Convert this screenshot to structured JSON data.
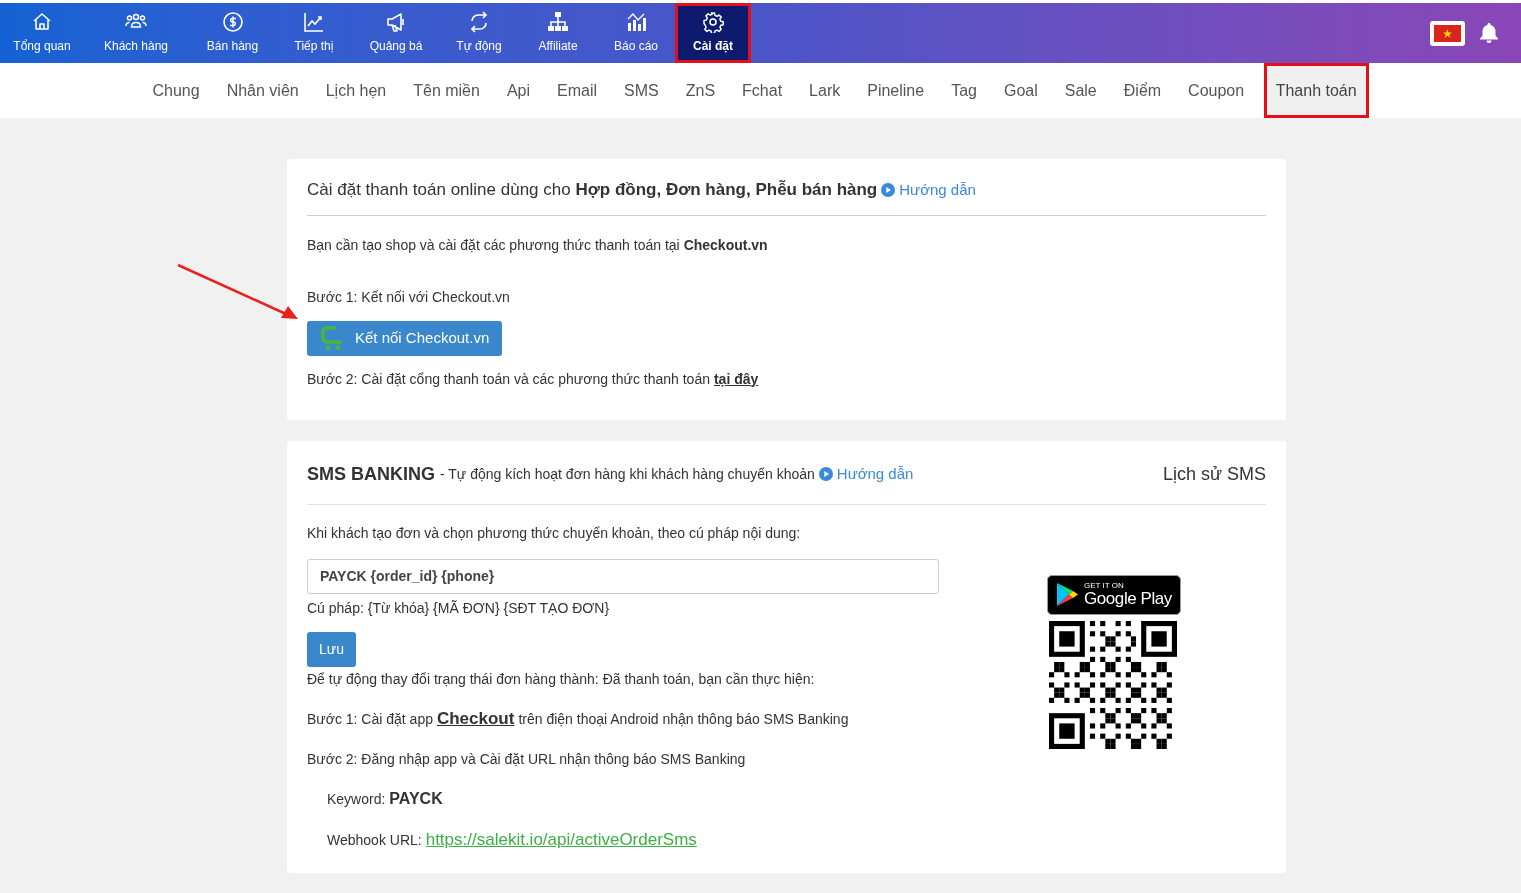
{
  "top_nav": [
    {
      "label": "Tổng quan",
      "selected": false
    },
    {
      "label": "Khách hàng",
      "selected": false
    },
    {
      "label": "Bán hàng",
      "selected": false
    },
    {
      "label": "Tiếp thị",
      "selected": false
    },
    {
      "label": "Quảng bá",
      "selected": false
    },
    {
      "label": "Tự động",
      "selected": false
    },
    {
      "label": "Affiliate",
      "selected": false
    },
    {
      "label": "Báo cáo",
      "selected": false
    },
    {
      "label": "Cài đặt",
      "selected": true
    }
  ],
  "sub_nav": [
    {
      "label": "Chung",
      "selected": false
    },
    {
      "label": "Nhân viên",
      "selected": false
    },
    {
      "label": "Lịch hẹn",
      "selected": false
    },
    {
      "label": "Tên miền",
      "selected": false
    },
    {
      "label": "Api",
      "selected": false
    },
    {
      "label": "Email",
      "selected": false
    },
    {
      "label": "SMS",
      "selected": false
    },
    {
      "label": "ZnS",
      "selected": false
    },
    {
      "label": "Fchat",
      "selected": false
    },
    {
      "label": "Lark",
      "selected": false
    },
    {
      "label": "Pineline",
      "selected": false
    },
    {
      "label": "Tag",
      "selected": false
    },
    {
      "label": "Goal",
      "selected": false
    },
    {
      "label": "Sale",
      "selected": false
    },
    {
      "label": "Điểm",
      "selected": false
    },
    {
      "label": "Coupon",
      "selected": false
    },
    {
      "label": "Thanh toán",
      "selected": true
    }
  ],
  "online_payment": {
    "title": "Cài đặt thanh toán online dùng cho **Hợp đồng, Đơn hàng, Phễu bán hàng**",
    "guide_link": "Hướng dẫn",
    "intro": "Bạn cần tạo shop và cài đặt các phương thức thanh toán tại **Checkout.vn**",
    "step_1": "Bước 1: Kết nối với Checkout.vn",
    "connect_button": "Kết nối Checkout.vn",
    "step_2": "Bước 2: Cài đặt cổng thanh toán và các phương thức thanh toán",
    "step_2_link": "tại đây"
  },
  "sms_banking": {
    "title": "SMS BANKING",
    "subtitle": "- Tự động kích hoạt đơn hàng khi khách hàng chuyển khoản",
    "guide_link": "Hướng dẫn",
    "history_link": "Lịch sử SMS",
    "instruction": "Khi khách tạo đơn và chọn phương thức chuyển khoản, theo cú pháp nội dung:",
    "syntax_value": "PAYCK {order_id} {phone}",
    "syntax_hint": "Cú pháp: {Từ khóa} {MÃ ĐƠN} {SĐT TẠO ĐƠN}",
    "save_button": "Lưu",
    "auto_note": "Để tự động thay đổi trạng thái đơn hàng thành: Đã thanh toán, bạn cần thực hiện:",
    "step_1_before": "Bước 1: Cài đặt app",
    "step_1_link": "Checkout",
    "step_1_after": "trên điện thoại Android nhận thông báo SMS Banking",
    "step_2": "Bước 2: Đăng nhập app và Cài đặt URL nhận thông báo SMS Banking",
    "keyword_label": "Keyword:",
    "keyword_value": "PAYCK",
    "webhook_label": "Webhook URL:",
    "webhook_url": "https://salekit.io/api/activeOrderSms",
    "store_badge": {
      "top": "GET IT ON",
      "bottom": "Google Play"
    }
  }
}
